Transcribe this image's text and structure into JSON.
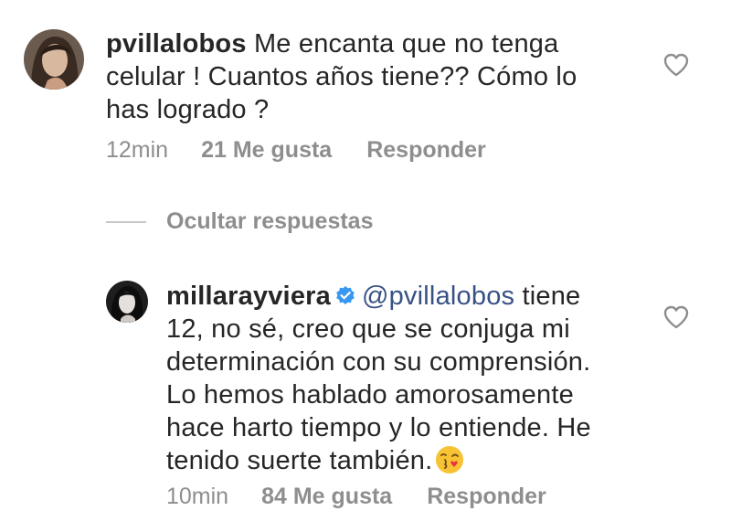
{
  "comment": {
    "username": "pvillalobos",
    "text": "Me encanta que no tenga celular ! Cuantos años tiene?? Cómo lo has logrado ?",
    "line1": "Me encanta que no tenga",
    "line2": "celular ! Cuantos años tiene?? Cómo lo",
    "line3": "has logrado ?",
    "time": "12min",
    "likes": "21 Me gusta",
    "reply_label": "Responder"
  },
  "replies_toggle": {
    "label": "Ocultar respuestas"
  },
  "reply": {
    "username": "millarayviera",
    "verified": true,
    "mention": "@pvillalobos",
    "line1_rest": "tiene",
    "line2": "12, no sé, creo que se conjuga mi",
    "line3": "determinación con su comprensión.",
    "line4": "Lo hemos hablado amorosamente",
    "line5": "hace harto tiempo y lo entiende. He",
    "line6": "tenido suerte también.",
    "emoji": "face-blowing-a-kiss",
    "time": "10min",
    "likes": "84 Me gusta",
    "reply_label": "Responder"
  },
  "colors": {
    "text": "#262626",
    "muted": "#8e8e8e",
    "mention": "#385185",
    "verified": "#3897f0"
  }
}
